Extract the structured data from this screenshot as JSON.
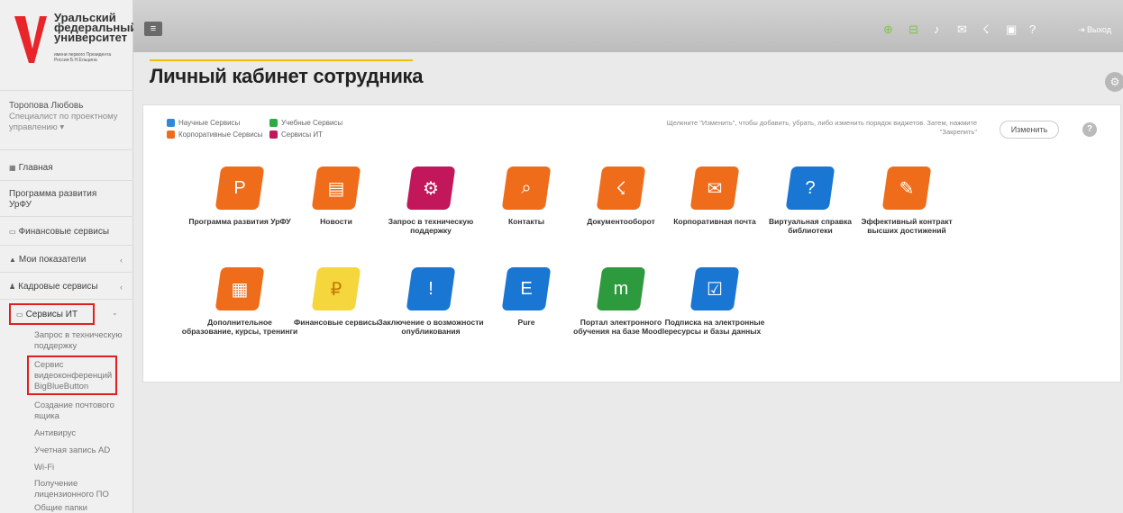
{
  "logo": {
    "title": "Уральский федеральный университет",
    "subtitle": "имени первого Президента России Б.Н.Ельцина"
  },
  "user": {
    "name": "Торопова Любовь",
    "role": "Специалист по проектному управлению ▾"
  },
  "nav": {
    "main": "Главная",
    "program": "Программа развития УрФУ",
    "finance": "Финансовые сервисы",
    "indicators": "Мои показатели",
    "hr": "Кадровые сервисы",
    "it": "Сервисы ИТ",
    "sub": [
      "Запрос в техническую поддержку",
      "Сервис видеоконференций BigBlueButton",
      "Создание почтового ящика",
      "Антивирус",
      "Учетная запись AD",
      "Wi-Fi",
      "Получение лицензионного ПО",
      "Общие папки"
    ]
  },
  "topbar": {
    "logout": "Выход"
  },
  "page": {
    "title": "Личный кабинет сотрудника"
  },
  "legend": [
    {
      "label": "Научные Сервисы",
      "color": "#2e8ad8"
    },
    {
      "label": "Учебные Сервисы",
      "color": "#2eaa44"
    },
    {
      "label": "Корпоративные Сервисы",
      "color": "#ef6c1a"
    },
    {
      "label": "Сервисы ИТ",
      "color": "#c2185b"
    }
  ],
  "hint": "Щелкните \"Изменить\", чтобы добавить, убрать, либо изменить порядок виджетов. Затем, нажмите \"Закрепить\"",
  "edit_label": "Изменить",
  "tiles": [
    {
      "label": "Программа развития УрФУ",
      "color": "#ef6c1a",
      "glyph": "P"
    },
    {
      "label": "Новости",
      "color": "#ef6c1a",
      "glyph": "▤"
    },
    {
      "label": "Запрос в техническую поддержку",
      "color": "#c2185b",
      "glyph": "⚙"
    },
    {
      "label": "Контакты",
      "color": "#ef6c1a",
      "glyph": "⌕"
    },
    {
      "label": "Документооборот",
      "color": "#ef6c1a",
      "glyph": "☇"
    },
    {
      "label": "Корпоративная почта",
      "color": "#ef6c1a",
      "glyph": "✉"
    },
    {
      "label": "Виртуальная справка библиотеки",
      "color": "#1976d2",
      "glyph": "?"
    },
    {
      "label": "Эффективный контракт высших достижений",
      "color": "#ef6c1a",
      "glyph": "✎"
    },
    {
      "label": "Дополнительное образование, курсы, тренинги",
      "color": "#ef6c1a",
      "glyph": "▦"
    },
    {
      "label": "Финансовые сервисы",
      "color": "#f5d63c",
      "glyph": "₽"
    },
    {
      "label": "Заключение о возможности опубликования",
      "color": "#1976d2",
      "glyph": "!"
    },
    {
      "label": "Pure",
      "color": "#1976d2",
      "glyph": "E"
    },
    {
      "label": "Портал электронного обучения на базе Moodle",
      "color": "#2e9a3e",
      "glyph": "m"
    },
    {
      "label": "Подписка на электронные ресурсы и базы данных",
      "color": "#1976d2",
      "glyph": "☑"
    }
  ]
}
